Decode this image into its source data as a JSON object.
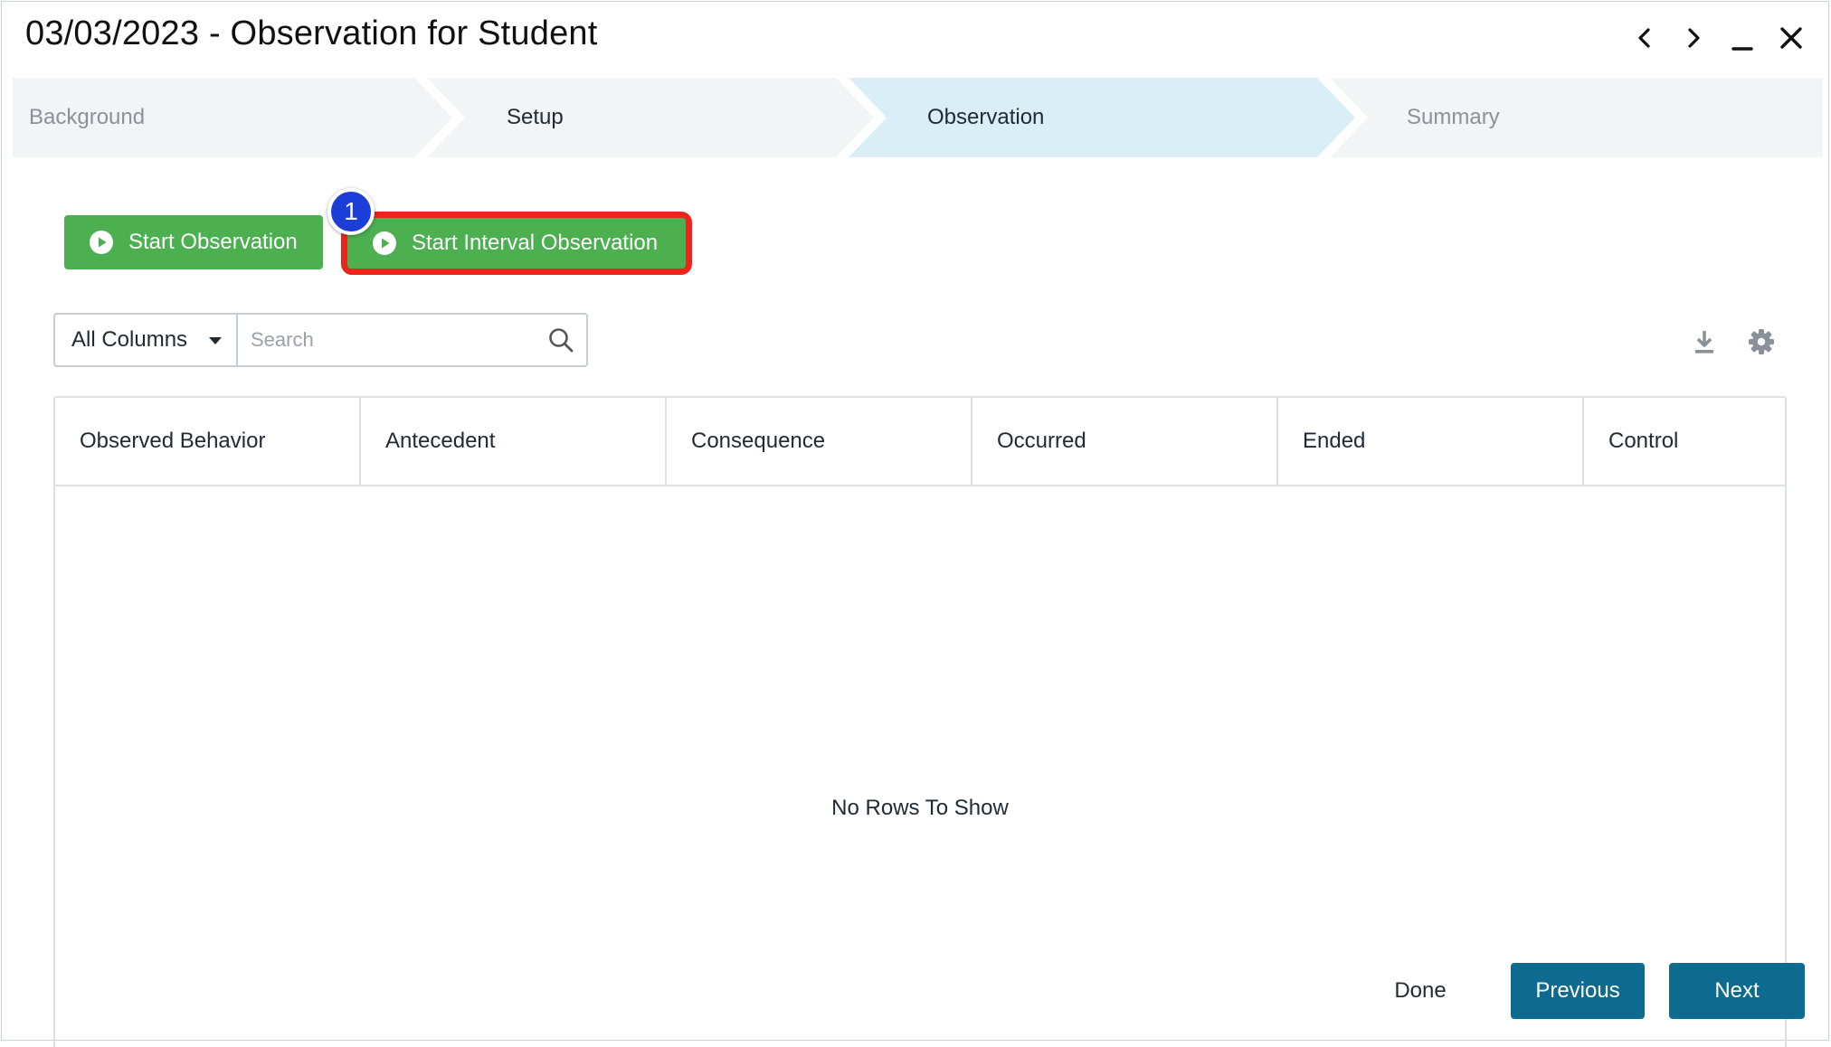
{
  "window": {
    "title": "03/03/2023 - Observation for Student",
    "controls": [
      {
        "icon": "chevron-left-icon"
      },
      {
        "icon": "chevron-right-icon"
      },
      {
        "icon": "minimize-icon"
      },
      {
        "icon": "close-icon"
      }
    ]
  },
  "stepper": {
    "steps": [
      {
        "label": "Background",
        "state": "inactive"
      },
      {
        "label": "Setup",
        "state": "default"
      },
      {
        "label": "Observation",
        "state": "active"
      },
      {
        "label": "Summary",
        "state": "inactive"
      }
    ],
    "colors": {
      "inactive_bg": "#f2f4f6",
      "active_bg": "#d9eef6",
      "inactive_text": "#8a9299",
      "text": "#1f2a33"
    }
  },
  "actions": {
    "start_observation_label": "Start Observation",
    "start_interval_label": "Start Interval Observation",
    "callout_number": "1",
    "colors": {
      "button_green": "#4caf50",
      "highlight_red": "#e8261c",
      "badge_blue": "#1b3fd6"
    }
  },
  "search": {
    "column_select_value": "All Columns",
    "placeholder": "Search"
  },
  "toolbar": {
    "download_icon": "download-icon",
    "settings_icon": "gear-icon"
  },
  "grid": {
    "columns": [
      "Observed Behavior",
      "Antecedent",
      "Consequence",
      "Occurred",
      "Ended",
      "Control"
    ],
    "empty_message": "No Rows To Show"
  },
  "footer": {
    "done_label": "Done",
    "previous_label": "Previous",
    "next_label": "Next",
    "primary_color": "#0e6b8f"
  }
}
